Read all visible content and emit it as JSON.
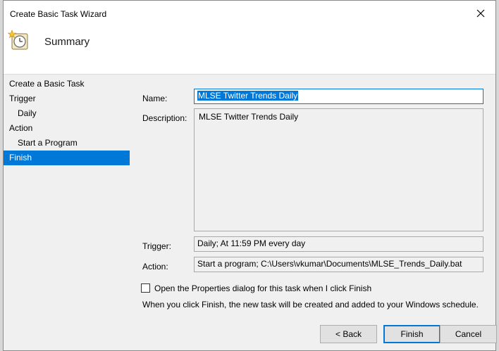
{
  "window": {
    "title": "Create Basic Task Wizard"
  },
  "header": {
    "title": "Summary",
    "icon": "task-scheduler-icon"
  },
  "steps": [
    {
      "label": "Create a Basic Task"
    },
    {
      "label": "Trigger"
    },
    {
      "label": "Daily"
    },
    {
      "label": "Action"
    },
    {
      "label": "Start a Program"
    },
    {
      "label": "Finish"
    }
  ],
  "form": {
    "name_label": "Name:",
    "name_value": "MLSE Twitter Trends Daily",
    "description_label": "Description:",
    "description_value": "MLSE Twitter Trends Daily",
    "trigger_label": "Trigger:",
    "trigger_value": "Daily; At 11:59 PM every day",
    "action_label": "Action:",
    "action_value": "Start a program; C:\\Users\\vkumar\\Documents\\MLSE_Trends_Daily.bat"
  },
  "checkbox": {
    "label": "Open the Properties dialog for this task when I click Finish",
    "checked": false
  },
  "info_text": "When you click Finish, the new task will be created and added to your Windows schedule.",
  "buttons": {
    "back": "< Back",
    "finish": "Finish",
    "cancel": "Cancel"
  },
  "colors": {
    "selection": "#0078d7",
    "focus_border": "#0078d7"
  }
}
